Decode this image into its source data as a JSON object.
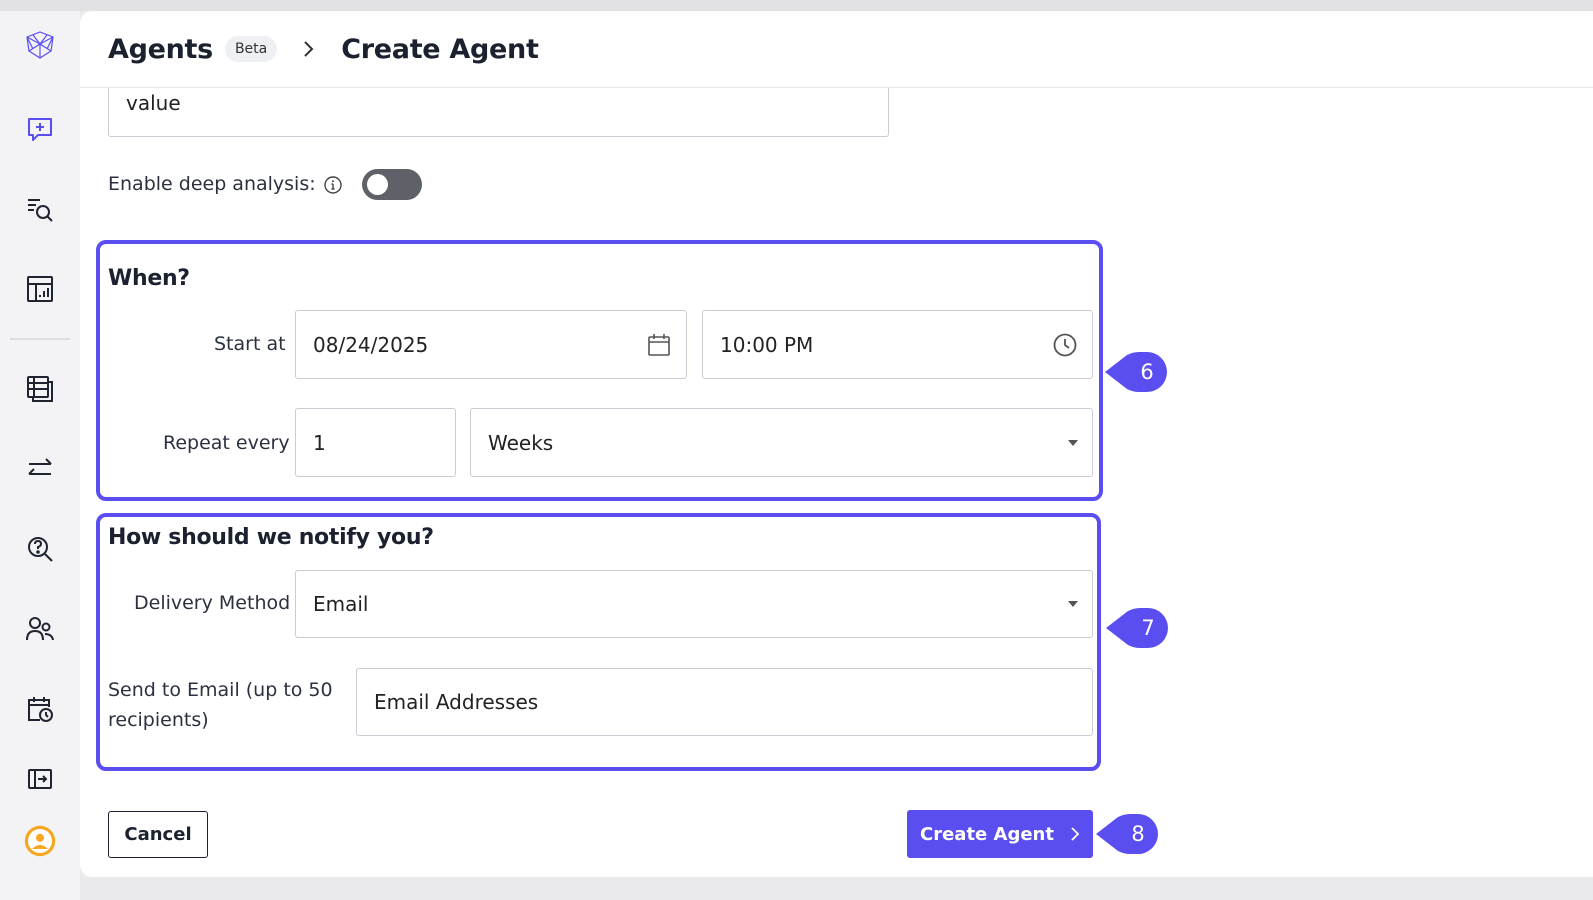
{
  "header": {
    "section": "Agents",
    "badge": "Beta",
    "title": "Create Agent"
  },
  "sidebar": {
    "items": [
      {
        "icon": "logo-icon"
      },
      {
        "icon": "new-chat-icon"
      },
      {
        "icon": "search-list-icon"
      },
      {
        "icon": "dashboard-icon"
      },
      {
        "icon": "table-icon"
      },
      {
        "icon": "transfer-icon"
      },
      {
        "icon": "question-search-icon"
      },
      {
        "icon": "users-icon"
      },
      {
        "icon": "schedule-icon"
      },
      {
        "icon": "exit-icon"
      },
      {
        "icon": "avatar-icon"
      }
    ]
  },
  "form": {
    "prev_field_value": "value",
    "deep_analysis_label": "Enable deep analysis:",
    "deep_analysis_enabled": false
  },
  "when": {
    "title": "When?",
    "start_label": "Start at",
    "start_date": "08/24/2025",
    "start_time": "10:00 PM",
    "repeat_label": "Repeat every",
    "repeat_value": "1",
    "repeat_unit": "Weeks"
  },
  "notify": {
    "title": "How should we notify you?",
    "delivery_label": "Delivery Method",
    "delivery_value": "Email",
    "send_label": "Send to Email (up to 50 recipients)",
    "email_placeholder": "Email Addresses"
  },
  "buttons": {
    "cancel": "Cancel",
    "create": "Create Agent"
  },
  "markers": [
    "6",
    "7",
    "8"
  ],
  "colors": {
    "accent": "#5b4ef0",
    "sidebar_bg": "#f3f3f5",
    "avatar": "#f5a623"
  }
}
